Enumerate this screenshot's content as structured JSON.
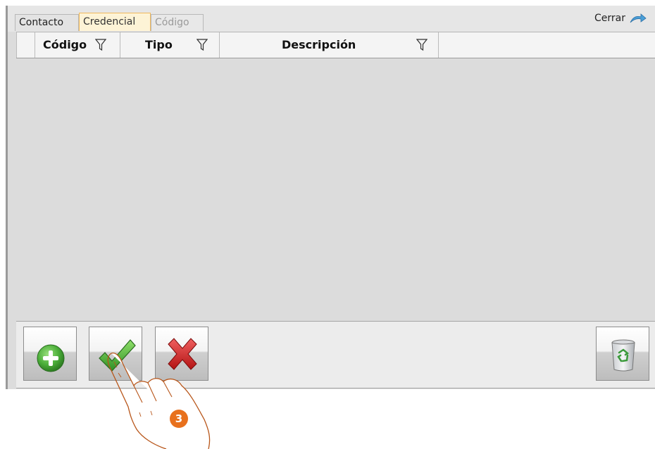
{
  "tabs": [
    {
      "label": "Contacto",
      "state": "normal"
    },
    {
      "label": "Credencial",
      "state": "active"
    },
    {
      "label": "Código",
      "state": "disabled"
    }
  ],
  "close": {
    "label": "Cerrar",
    "icon": "close-arrow-icon"
  },
  "grid": {
    "columns": [
      {
        "label": "Código",
        "icon": "filter-icon"
      },
      {
        "label": "Tipo",
        "icon": "filter-icon"
      },
      {
        "label": "Descripción",
        "icon": "filter-icon"
      }
    ],
    "rows": []
  },
  "toolbar": {
    "buttons": [
      {
        "name": "add",
        "icon": "plus-icon"
      },
      {
        "name": "accept",
        "icon": "checkmark-icon"
      },
      {
        "name": "cancel",
        "icon": "x-icon"
      },
      {
        "name": "delete",
        "icon": "trash-icon"
      }
    ]
  },
  "annotation": {
    "step": "3"
  },
  "colors": {
    "active_tab_bg": "#fdf3d6",
    "active_tab_border": "#f0b85a",
    "badge": "#e8711d",
    "add_green": "#4caf3a",
    "cancel_red": "#d41f1f"
  }
}
